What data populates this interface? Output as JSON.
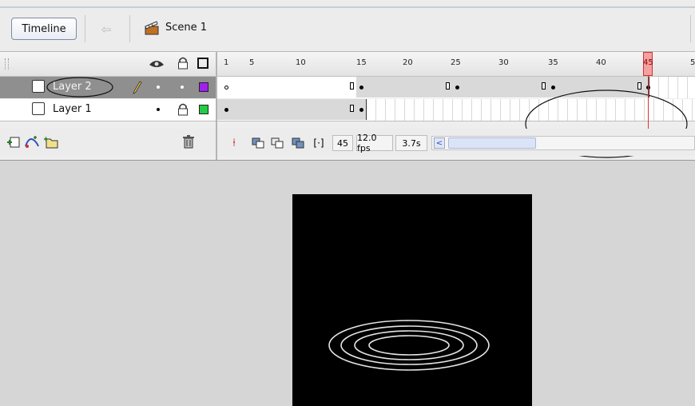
{
  "toolbar": {
    "timeline_label": "Timeline",
    "scene_label": "Scene 1"
  },
  "ruler": {
    "labels": [
      "1",
      "5",
      "10",
      "15",
      "20",
      "25",
      "30",
      "35",
      "40",
      "45",
      "5"
    ],
    "current_frame": "45"
  },
  "layers": [
    {
      "name": "Layer 2",
      "selected": true,
      "color": "#a020f0"
    },
    {
      "name": "Layer 1",
      "selected": false,
      "color": "#22cc44"
    }
  ],
  "status": {
    "frame": "45",
    "fps": "12.0 fps",
    "time": "3.7s"
  },
  "colors": {
    "playhead": "#e03030",
    "stage": "#000000"
  }
}
